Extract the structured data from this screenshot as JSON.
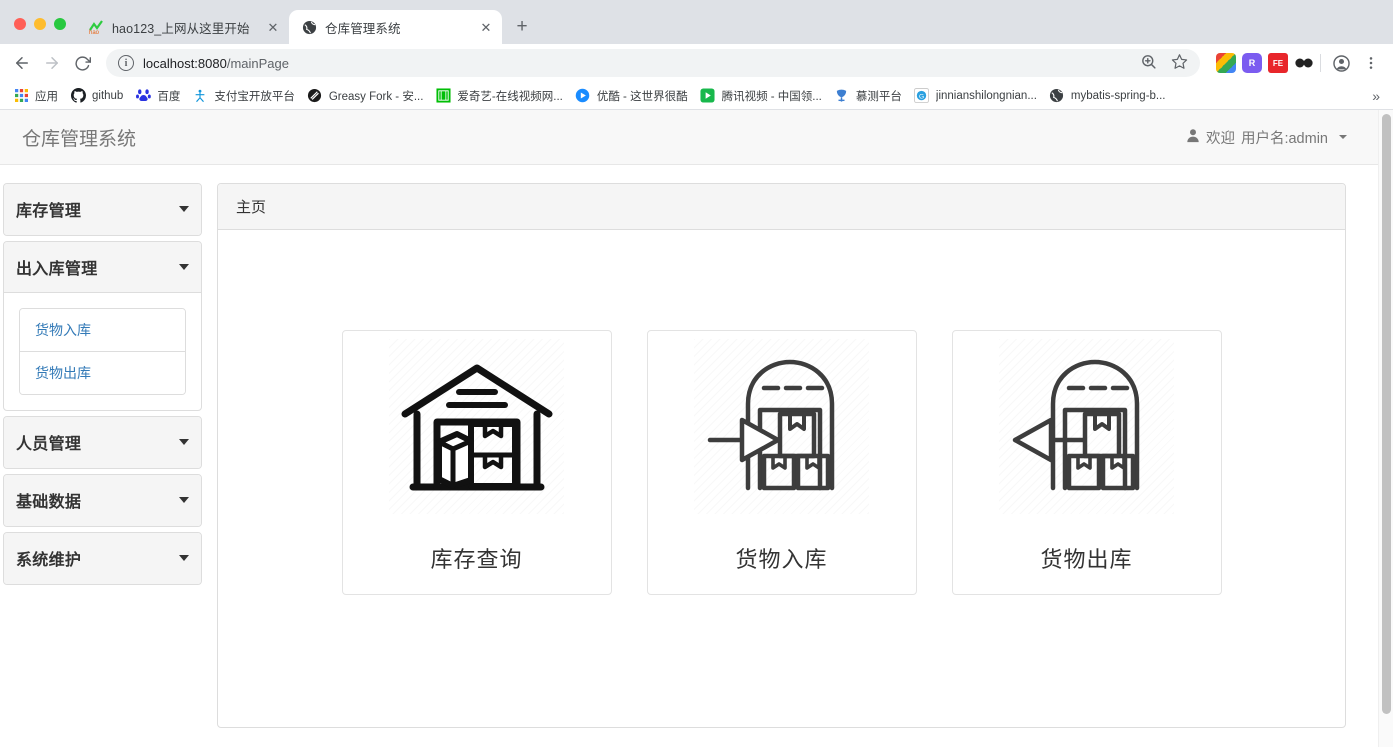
{
  "browser": {
    "window_controls": [
      "close",
      "minimize",
      "maximize"
    ],
    "tabs": [
      {
        "title": "hao123_上网从这里开始",
        "favicon": "hao123-icon",
        "active": false,
        "close_label": "✕"
      },
      {
        "title": "仓库管理系统",
        "favicon": "globe-icon",
        "active": true,
        "close_label": "✕"
      }
    ],
    "new_tab_label": "+",
    "nav": {
      "back": "←",
      "forward": "→",
      "reload": "⟳"
    },
    "omnibox": {
      "info_glyph": "i",
      "url_prefix": "localhost:8080",
      "url_path": "/mainPage",
      "zoom_icon": "zoom-search-icon",
      "bookmark_icon": "star-icon"
    },
    "extensions": [
      {
        "name": "colorful-extension",
        "label": ""
      },
      {
        "name": "purple-hex-extension",
        "label": "R"
      },
      {
        "name": "fe-extension",
        "label": "FE"
      },
      {
        "name": "dark-glasses-extension",
        "label": ""
      }
    ],
    "profile_icon": "account-icon",
    "menu_icon": "three-dot-menu-icon",
    "bookmarks": [
      {
        "label": "应用",
        "icon": "apps-grid-icon"
      },
      {
        "label": "github",
        "icon": "github-icon"
      },
      {
        "label": "百度",
        "icon": "baidu-icon"
      },
      {
        "label": "支付宝开放平台",
        "icon": "alipay-icon"
      },
      {
        "label": "Greasy Fork - 安...",
        "icon": "greasyfork-icon"
      },
      {
        "label": "爱奇艺-在线视频网...",
        "icon": "iqiyi-icon"
      },
      {
        "label": "优酷 - 这世界很酷",
        "icon": "youku-icon"
      },
      {
        "label": "腾讯视频 - 中国领...",
        "icon": "tencent-video-icon"
      },
      {
        "label": "慕测平台",
        "icon": "mooctest-icon"
      },
      {
        "label": "jinnianshilongnian...",
        "icon": "blog-icon"
      },
      {
        "label": "mybatis-spring-b...",
        "icon": "globe-icon"
      }
    ],
    "bookmarks_overflow": "»"
  },
  "app": {
    "brand": "仓库管理系统",
    "user": {
      "greeting": "欢迎",
      "name_label": "用户名:admin",
      "icon": "user-avatar-icon"
    },
    "sidebar": {
      "menus": [
        {
          "title": "库存管理",
          "open": false,
          "items": []
        },
        {
          "title": "出入库管理",
          "open": true,
          "items": [
            {
              "label": "货物入库"
            },
            {
              "label": "货物出库"
            }
          ]
        },
        {
          "title": "人员管理",
          "open": false,
          "items": []
        },
        {
          "title": "基础数据",
          "open": false,
          "items": []
        },
        {
          "title": "系统维护",
          "open": false,
          "items": []
        }
      ]
    },
    "content": {
      "header": "主页",
      "cards": [
        {
          "label": "库存查询",
          "icon": "warehouse-boxes-icon"
        },
        {
          "label": "货物入库",
          "icon": "warehouse-inbound-arrow-icon"
        },
        {
          "label": "货物出库",
          "icon": "warehouse-outbound-arrow-icon"
        }
      ]
    },
    "colors": {
      "link": "#337ab7",
      "panel_head_bg": "#f5f5f5",
      "border": "#dddddd",
      "text": "#333333",
      "muted": "#777777"
    }
  }
}
